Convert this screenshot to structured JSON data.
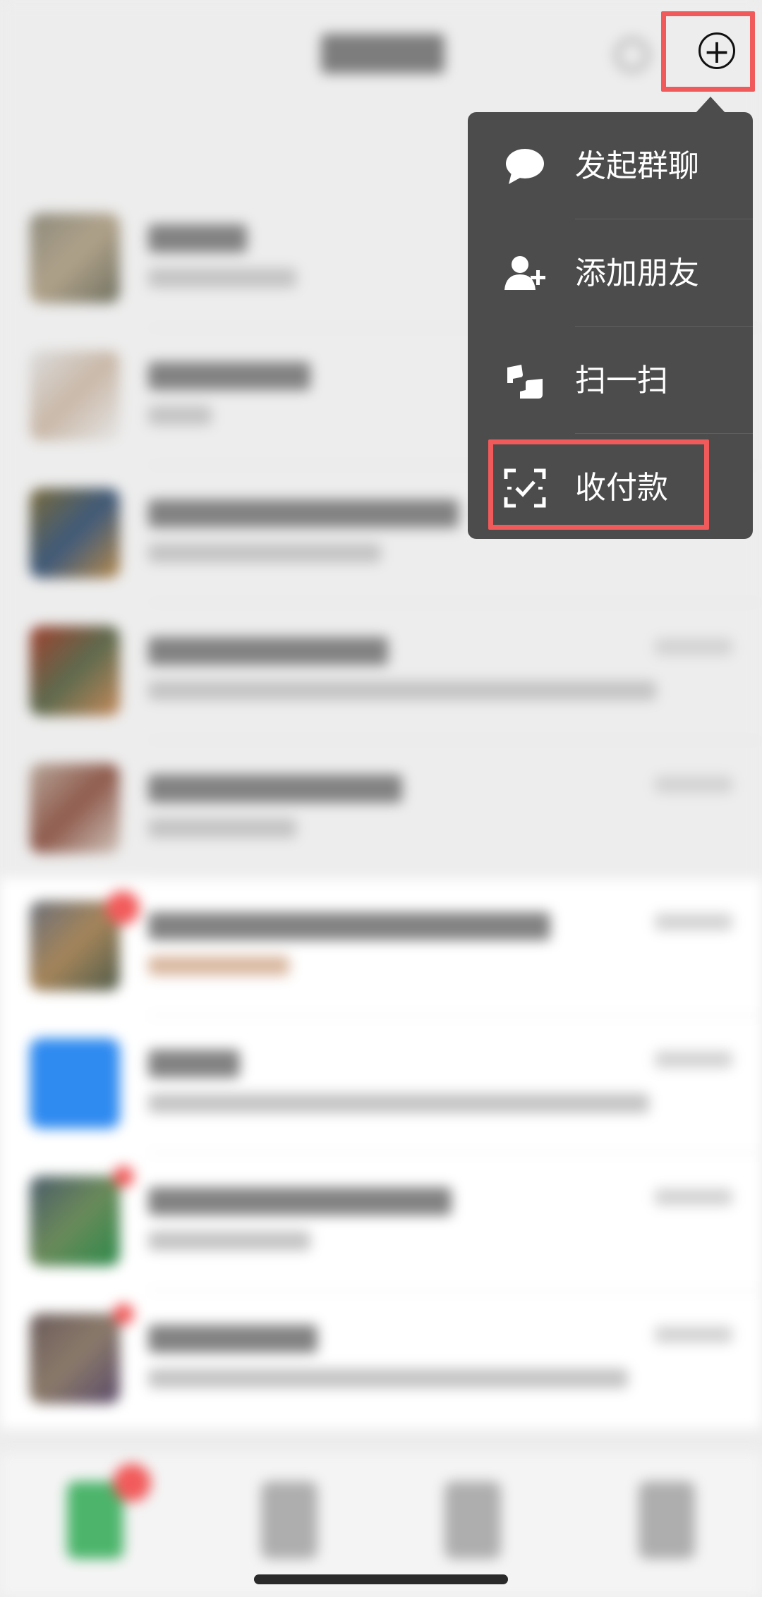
{
  "menu": {
    "items": [
      {
        "label": "发起群聊",
        "icon": "chat-bubble-icon"
      },
      {
        "label": "添加朋友",
        "icon": "add-friend-icon"
      },
      {
        "label": "扫一扫",
        "icon": "scan-icon"
      },
      {
        "label": "收付款",
        "icon": "payment-scan-icon"
      }
    ]
  },
  "header": {
    "add_icon": "plus-circle-icon",
    "search_icon": "search-icon"
  },
  "colors": {
    "menu_bg": "#4c4c4c",
    "highlight": "#f15a5a",
    "page_bg": "#ededed"
  }
}
